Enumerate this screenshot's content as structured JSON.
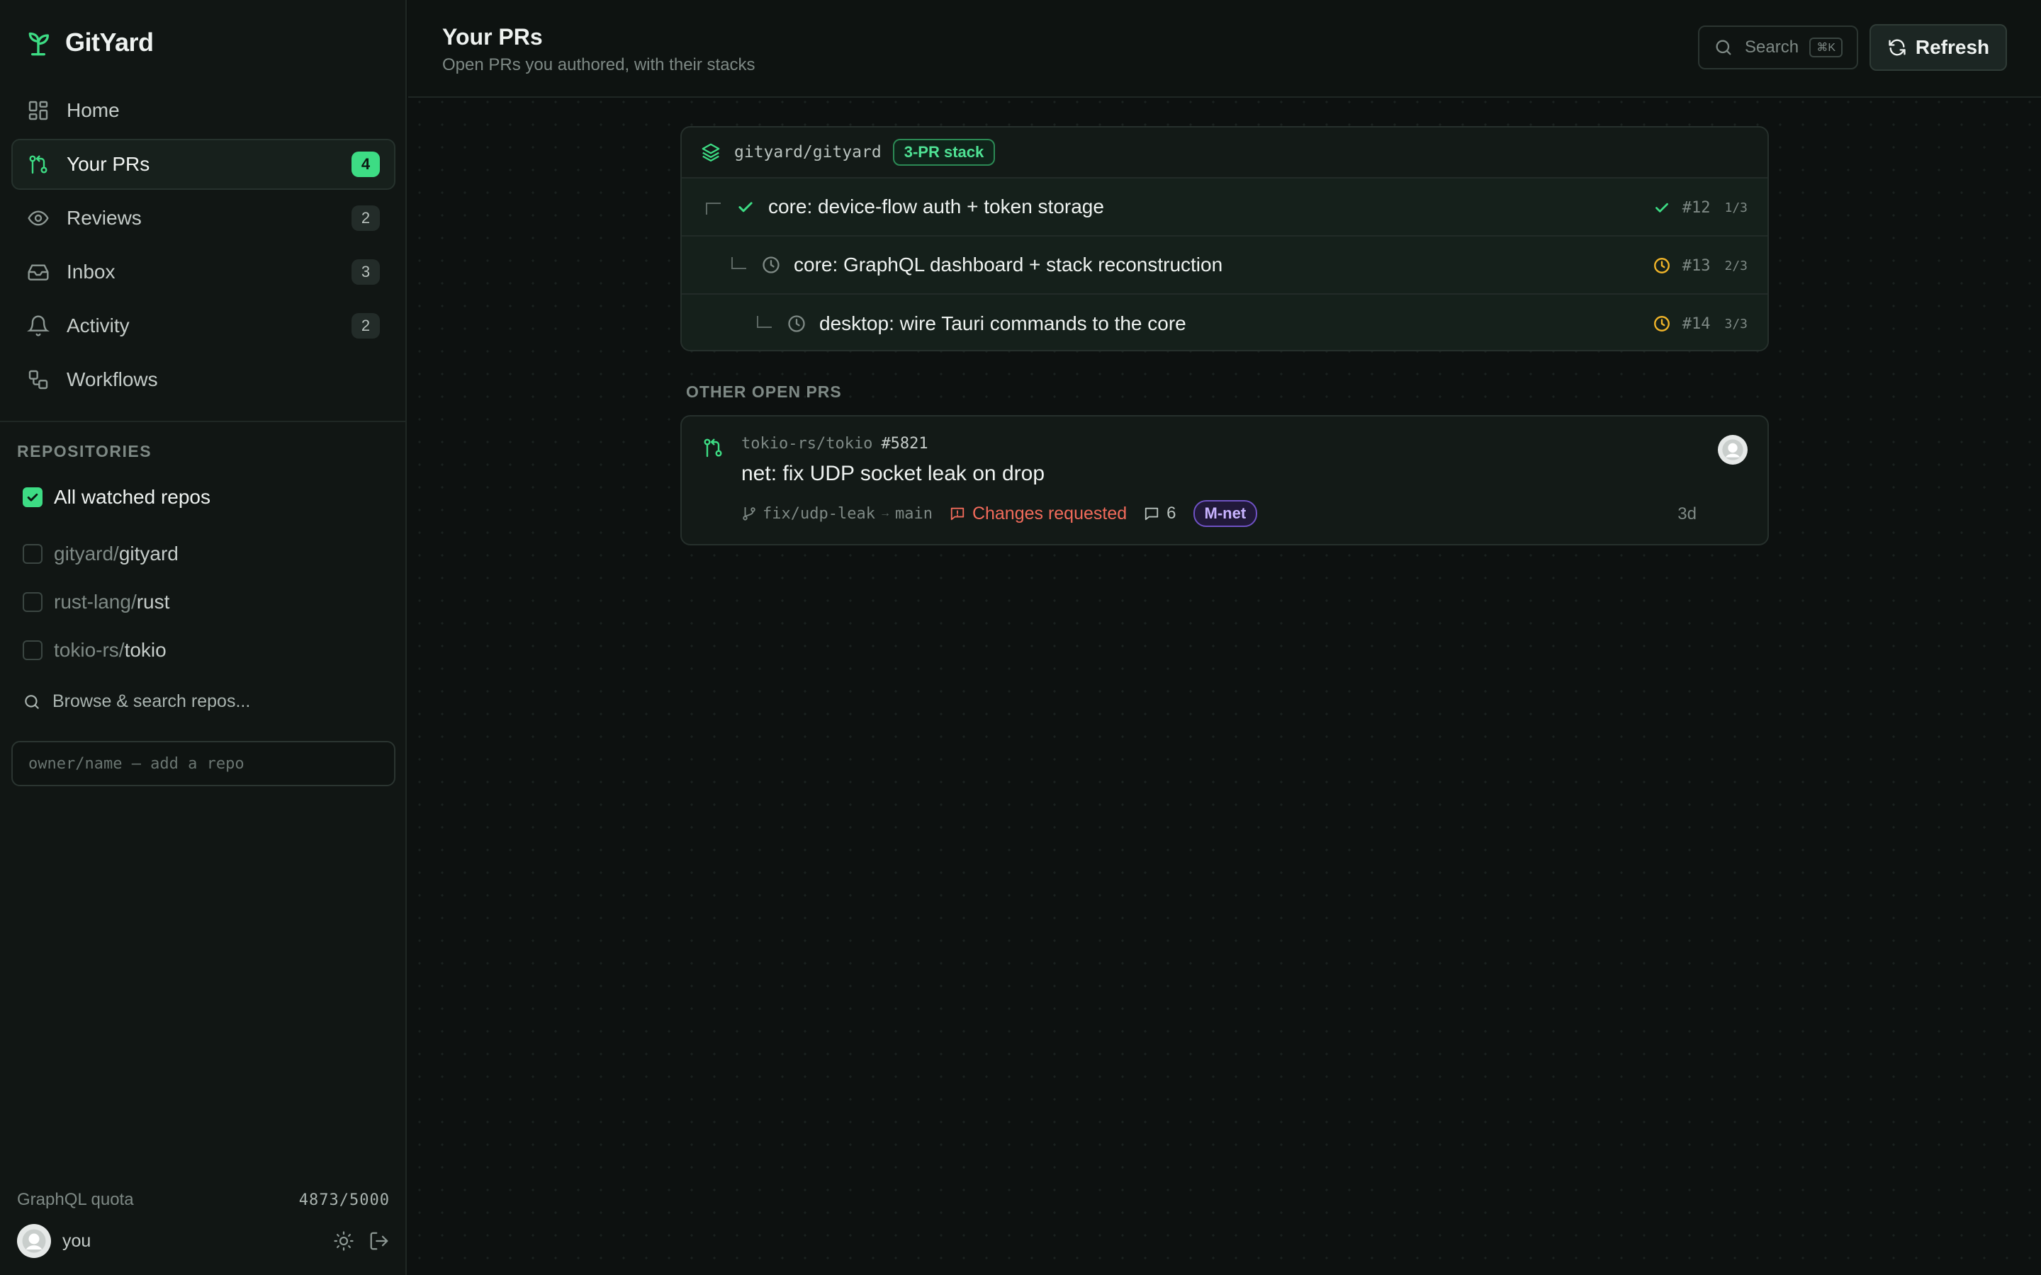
{
  "app": {
    "name": "GitYard",
    "accent": "#3ddc84"
  },
  "nav": [
    {
      "label": "Home",
      "icon": "grid-icon",
      "badge": ""
    },
    {
      "label": "Your PRs",
      "icon": "pull-request-icon",
      "badge": "4",
      "active": true
    },
    {
      "label": "Reviews",
      "icon": "eye-icon",
      "badge": "2"
    },
    {
      "label": "Inbox",
      "icon": "inbox-icon",
      "badge": "3"
    },
    {
      "label": "Activity",
      "icon": "bell-icon",
      "badge": "2"
    },
    {
      "label": "Workflows",
      "icon": "workflow-icon",
      "badge": ""
    }
  ],
  "repositories": {
    "heading": "REPOSITORIES",
    "all_label": "All watched repos",
    "items": [
      {
        "owner": "gityard/",
        "name": "gityard"
      },
      {
        "owner": "rust-lang/",
        "name": "rust"
      },
      {
        "owner": "tokio-rs/",
        "name": "tokio"
      }
    ],
    "browse_label": "Browse & search repos...",
    "add_placeholder": "owner/name — add a repo"
  },
  "footer": {
    "quota_label": "GraphQL quota",
    "quota_value": "4873/5000",
    "user_name": "you"
  },
  "header": {
    "title": "Your PRs",
    "subtitle": "Open PRs you authored, with their stacks",
    "search_label": "Search",
    "search_shortcut": "⌘K",
    "refresh_label": "Refresh"
  },
  "stack": {
    "repo": "gityard/gityard",
    "pill": "3-PR stack",
    "rows": [
      {
        "title": "core: device-flow auth + token storage",
        "number": "#12",
        "position": "1/3",
        "status": "passed"
      },
      {
        "title": "core: GraphQL dashboard + stack reconstruction",
        "number": "#13",
        "position": "2/3",
        "status": "pending"
      },
      {
        "title": "desktop: wire Tauri commands to the core",
        "number": "#14",
        "position": "3/3",
        "status": "pending"
      }
    ]
  },
  "other": {
    "heading": "OTHER OPEN PRS",
    "pr": {
      "repo": "tokio-rs/tokio",
      "number": "#5821",
      "title": "net: fix UDP socket leak on drop",
      "head_branch": "fix/udp-leak",
      "arrow": "→",
      "base_branch": "main",
      "review_status": "Changes requested",
      "comments": "6",
      "label": "M-net",
      "age": "3d"
    }
  }
}
